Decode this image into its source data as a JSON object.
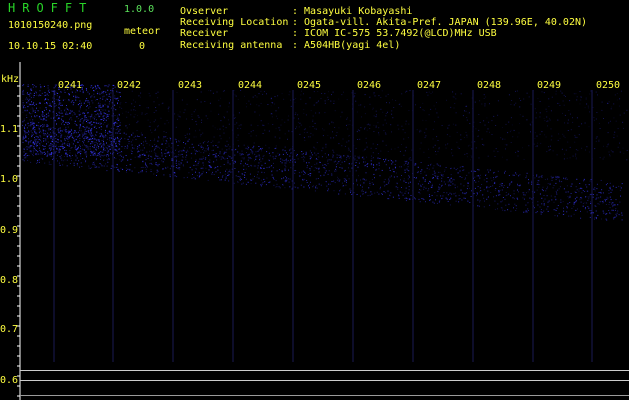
{
  "header": {
    "app_name": "HROFFT",
    "version": "1.0.0",
    "filename": "1010150240.png",
    "meteor_label": "meteor",
    "datetime": "10.10.15 02:40",
    "meteor_count": "0"
  },
  "info": [
    {
      "label": "Ovserver",
      "value": ": Masayuki Kobayashi"
    },
    {
      "label": "Receiving Location",
      "value": ": Ogata-vill. Akita-Pref. JAPAN (139.96E, 40.02N)"
    },
    {
      "label": "Receiver",
      "value": ": ICOM IC-575 53.7492(@LCD)MHz USB"
    },
    {
      "label": "Receiving antenna",
      "value": ": A504HB(yagi 4el)"
    }
  ],
  "spectrogram": {
    "freq_unit": "kHz",
    "y_labels": [
      "1.1",
      "1.0",
      "0.9",
      "0.8",
      "0.7",
      "0.6"
    ],
    "time_labels": [
      "0241",
      "0242",
      "0243",
      "0244",
      "0245",
      "0246",
      "0247",
      "0248",
      "0249",
      "0250"
    ],
    "colors": {
      "signal": "#3a3aff",
      "label": "#ffff40",
      "axis": "#ffffff"
    }
  }
}
